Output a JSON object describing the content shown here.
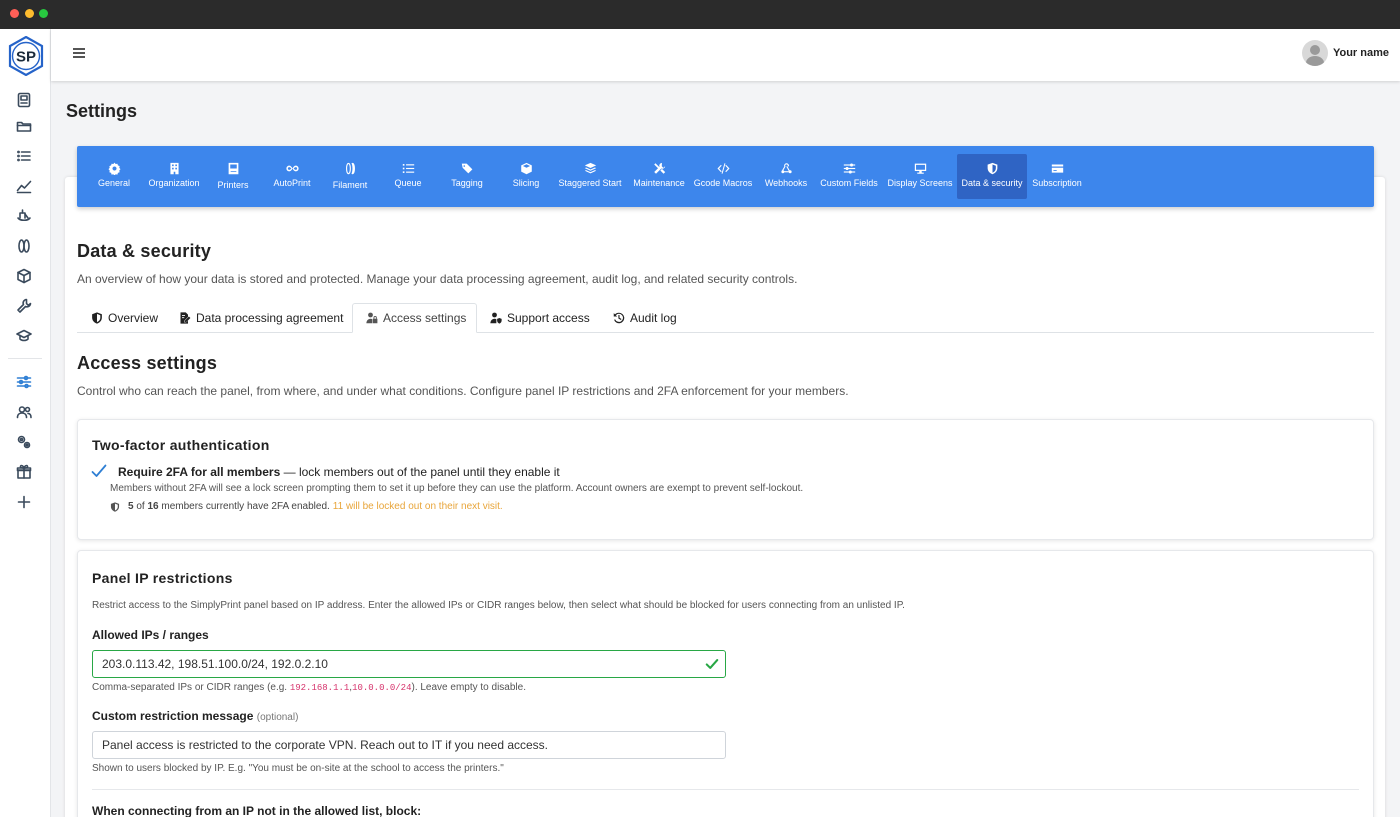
{
  "window": {
    "dots": [
      "#ff5f57",
      "#febc2e",
      "#28c840"
    ]
  },
  "logo": {
    "text": "SP",
    "color": "#2563c9"
  },
  "rail": {
    "icons": [
      "printer-icon",
      "folder-icon",
      "list-icon",
      "chart-icon",
      "ship-icon",
      "filament-icon",
      "box-icon",
      "wrench-icon",
      "graduation-icon"
    ],
    "icons2": [
      "sliders-icon",
      "users-icon",
      "gears-icon",
      "gift-icon",
      "plus-icon"
    ]
  },
  "header": {
    "user_name": "Your name"
  },
  "page": {
    "title": "Settings"
  },
  "settings_nav": {
    "items": [
      {
        "label": "General",
        "icon": "gear-icon"
      },
      {
        "label": "Organization",
        "icon": "building-icon"
      },
      {
        "label": "Printers",
        "icon": "printer-icon"
      },
      {
        "label": "AutoPrint",
        "icon": "infinity-icon"
      },
      {
        "label": "Filament",
        "icon": "filament-icon"
      },
      {
        "label": "Queue",
        "icon": "list-icon"
      },
      {
        "label": "Tagging",
        "icon": "tags-icon"
      },
      {
        "label": "Slicing",
        "icon": "cube-icon"
      },
      {
        "label": "Staggered Start",
        "icon": "layers-icon"
      },
      {
        "label": "Maintenance",
        "icon": "tools-icon"
      },
      {
        "label": "Gcode Macros",
        "icon": "code-icon"
      },
      {
        "label": "Webhooks",
        "icon": "webhook-icon"
      },
      {
        "label": "Custom Fields",
        "icon": "sliders-icon"
      },
      {
        "label": "Display Screens",
        "icon": "desktop-icon"
      },
      {
        "label": "Data & security",
        "icon": "shield-icon",
        "active": true
      },
      {
        "label": "Subscription",
        "icon": "credit-card-icon"
      }
    ]
  },
  "section": {
    "title": "Data & security",
    "description": "An overview of how your data is stored and protected. Manage your data processing agreement, audit log, and related security controls."
  },
  "tabs": [
    {
      "label": "Overview",
      "icon": "shield-icon"
    },
    {
      "label": "Data processing agreement",
      "icon": "file-signature-icon"
    },
    {
      "label": "Access settings",
      "icon": "user-lock-icon",
      "active": true
    },
    {
      "label": "Support access",
      "icon": "user-shield-icon"
    },
    {
      "label": "Audit log",
      "icon": "history-icon"
    }
  ],
  "access": {
    "title": "Access settings",
    "description": "Control who can reach the panel, from where, and under what conditions. Configure panel IP restrictions and 2FA enforcement for your members."
  },
  "twofa": {
    "title": "Two-factor authentication",
    "require_bold": "Require 2FA for all members",
    "require_rest": " — lock members out of the panel until they enable it",
    "checked": true,
    "help": "Members without 2FA will see a lock screen prompting them to set it up before they can use the platform. Account owners are exempt to prevent self-lockout.",
    "enabled_count": "5",
    "of_text": " of ",
    "total_count": "16",
    "status_text": " members currently have 2FA enabled.",
    "warning": "11 will be locked out on their next visit.",
    "warning_color": "#e8a53a"
  },
  "ip": {
    "title": "Panel IP restrictions",
    "description": "Restrict access to the SimplyPrint panel based on IP address. Enter the allowed IPs or CIDR ranges below, then select what should be blocked for users connecting from an unlisted IP.",
    "allowed_label": "Allowed IPs / ranges",
    "allowed_value": "203.0.113.42, 198.51.100.0/24, 192.0.2.10",
    "hint_pre": "Comma-separated IPs or CIDR ranges (e.g. ",
    "hint_code1": "192.168.1.1",
    "hint_comma": ",",
    "hint_code2": "10.0.0.0/24",
    "hint_post": "). Leave empty to disable.",
    "message_label": "Custom restriction message",
    "message_optional": "(optional)",
    "message_value": "Panel access is restricted to the corporate VPN. Reach out to IT if you need access.",
    "message_hint": "Shown to users blocked by IP. E.g. \"You must be on-site at the school to access the printers.\"",
    "block_label": "When connecting from an IP not in the allowed list, block:"
  }
}
